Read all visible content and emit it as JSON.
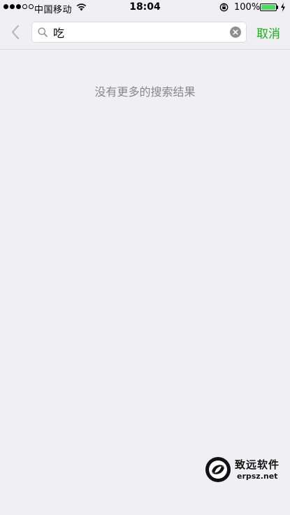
{
  "status_bar": {
    "carrier": "中国移动",
    "time": "18:04",
    "battery_percent": "100%",
    "icons": [
      "signal-dots",
      "wifi-icon",
      "orientation-lock-icon",
      "battery-icon",
      "charging-icon"
    ],
    "battery_color": "#4cd964"
  },
  "search": {
    "query": "吃",
    "back_icon": "chevron-left-icon",
    "search_icon": "magnifier-icon",
    "clear_icon": "clear-circle-icon",
    "cancel_label": "取消",
    "accent_color": "#1aad19"
  },
  "results": {
    "empty_message": "没有更多的搜索结果"
  },
  "watermark": {
    "brand": "致远软件",
    "url": "erpsz.net"
  }
}
